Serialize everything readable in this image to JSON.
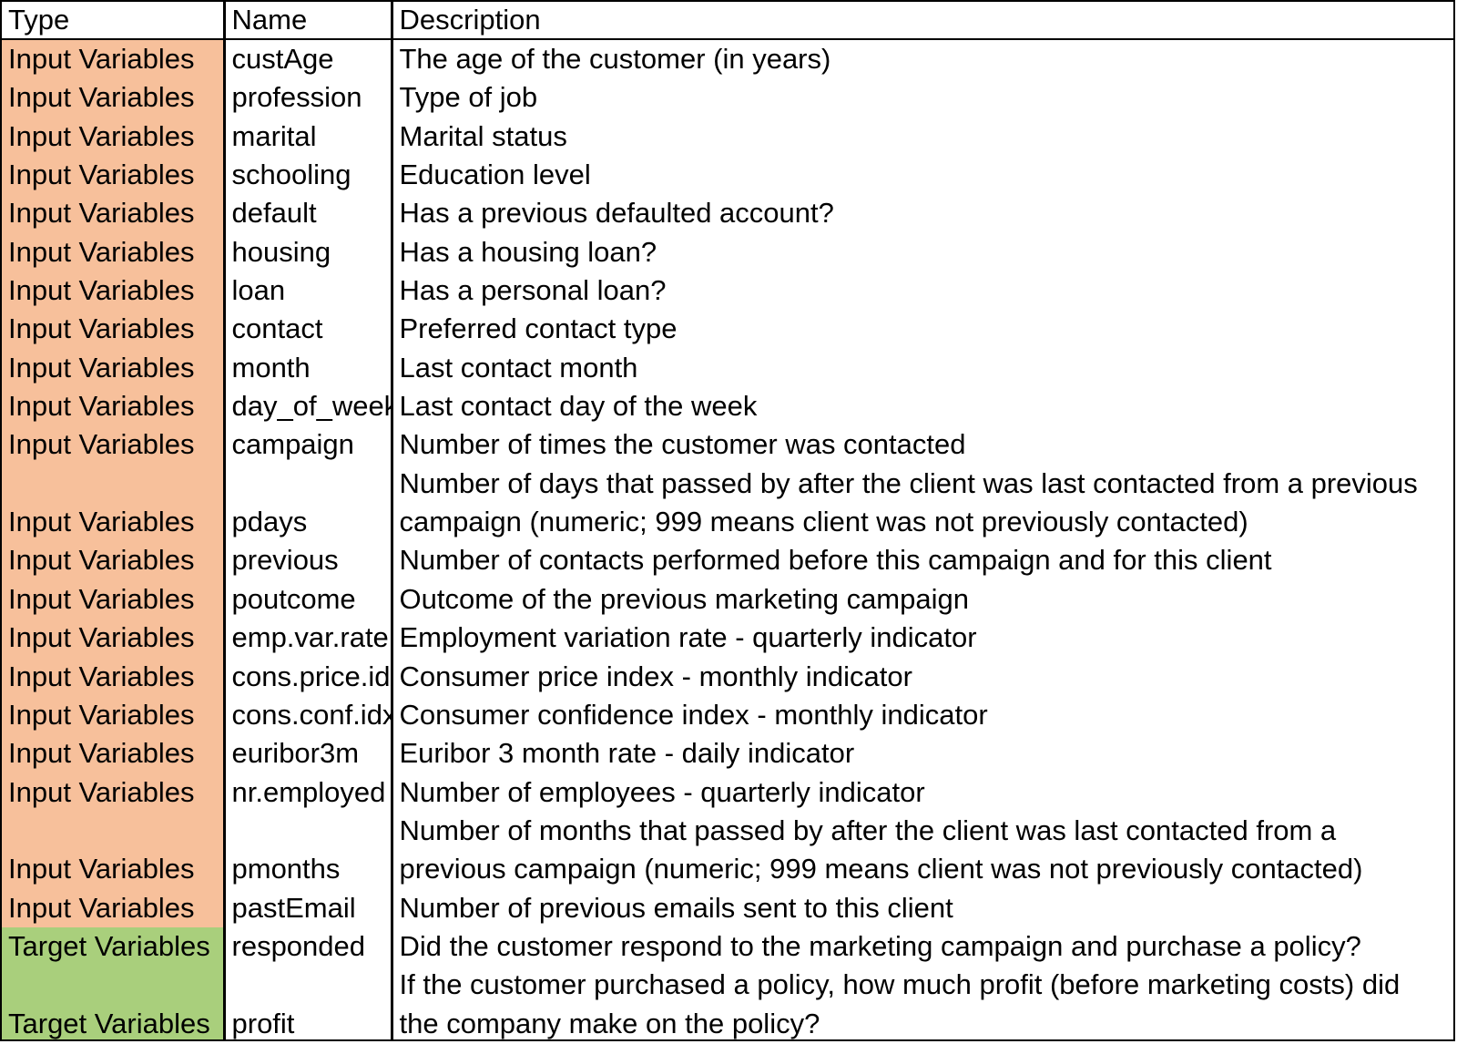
{
  "table": {
    "headers": {
      "type": "Type",
      "name": "Name",
      "description": "Description"
    },
    "category_colors": {
      "Input Variables": "#f7c09b",
      "Target Variables": "#a9cf7c"
    },
    "rows": [
      {
        "type": "Input Variables",
        "name": "custAge",
        "description": "The age of the customer (in years)"
      },
      {
        "type": "Input Variables",
        "name": "profession",
        "description": "Type of job"
      },
      {
        "type": "Input Variables",
        "name": "marital",
        "description": "Marital status"
      },
      {
        "type": "Input Variables",
        "name": "schooling",
        "description": "Education level"
      },
      {
        "type": "Input Variables",
        "name": "default",
        "description": "Has a previous defaulted account?"
      },
      {
        "type": "Input Variables",
        "name": "housing",
        "description": "Has a housing loan?"
      },
      {
        "type": "Input Variables",
        "name": "loan",
        "description": "Has a personal loan?"
      },
      {
        "type": "Input Variables",
        "name": "contact",
        "description": "Preferred contact type"
      },
      {
        "type": "Input Variables",
        "name": "month",
        "description": "Last contact month"
      },
      {
        "type": "Input Variables",
        "name": "day_of_week",
        "description": "Last contact day of the week"
      },
      {
        "type": "Input Variables",
        "name": "campaign",
        "description": "Number of times the customer was contacted"
      },
      {
        "type": "Input Variables",
        "name": "pdays",
        "description": "Number of days that passed by after the client was last contacted from a previous campaign (numeric; 999 means client was not previously contacted)",
        "tall": true
      },
      {
        "type": "Input Variables",
        "name": "previous",
        "description": "Number of contacts performed before this campaign and for this client"
      },
      {
        "type": "Input Variables",
        "name": "poutcome",
        "description": "Outcome of the previous marketing campaign"
      },
      {
        "type": "Input Variables",
        "name": "emp.var.rate",
        "description": "Employment variation rate - quarterly indicator"
      },
      {
        "type": "Input Variables",
        "name": "cons.price.idx",
        "description": "Consumer price index - monthly indicator"
      },
      {
        "type": "Input Variables",
        "name": "cons.conf.idx",
        "description": "Consumer confidence index - monthly indicator"
      },
      {
        "type": "Input Variables",
        "name": "euribor3m",
        "description": "Euribor 3 month rate - daily indicator"
      },
      {
        "type": "Input Variables",
        "name": "nr.employed",
        "description": "Number of employees - quarterly indicator"
      },
      {
        "type": "Input Variables",
        "name": "pmonths",
        "description": "Number of months that passed by after the client was last contacted from a previous campaign (numeric; 999 means client was not previously contacted)",
        "tall": true
      },
      {
        "type": "Input Variables",
        "name": "pastEmail",
        "description": "Number of previous emails sent to this client"
      },
      {
        "type": "Target Variables",
        "name": "responded",
        "description": "Did the customer respond to the marketing campaign and purchase a policy?"
      },
      {
        "type": "Target Variables",
        "name": "profit",
        "description": "If the customer purchased a policy, how much profit (before marketing costs) did the company make on the policy?",
        "tall": true
      }
    ]
  }
}
